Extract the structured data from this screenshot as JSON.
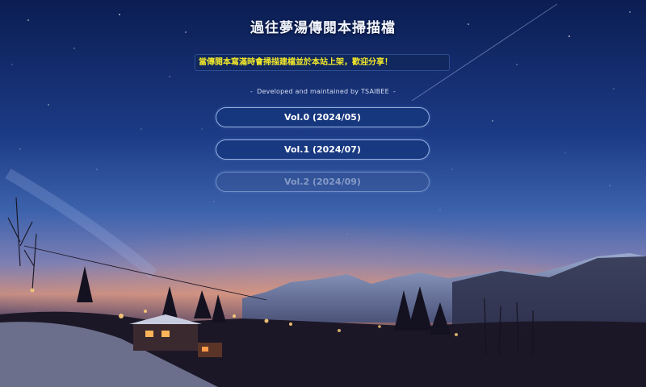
{
  "page": {
    "title": "過往夢湯傳閱本掃描檔",
    "notice": "當傳閱本寫滿時會掃描建檔並於本站上架，歡迎分享！",
    "credit_dash_left": "-",
    "credit": "Developed and maintained by TSAIBEE",
    "credit_dash_right": "-"
  },
  "volumes": [
    {
      "label": "Vol.0 (2024/05)",
      "enabled": true
    },
    {
      "label": "Vol.1 (2024/07)",
      "enabled": true
    },
    {
      "label": "Vol.2 (2024/09)",
      "enabled": false
    }
  ],
  "colors": {
    "notice_text": "#f4ea2a",
    "button_fill": "#16377d",
    "sky_top": "#0b1d52",
    "sky_horizon": "#c07a6a"
  },
  "background": "starry-night-mountain-village"
}
